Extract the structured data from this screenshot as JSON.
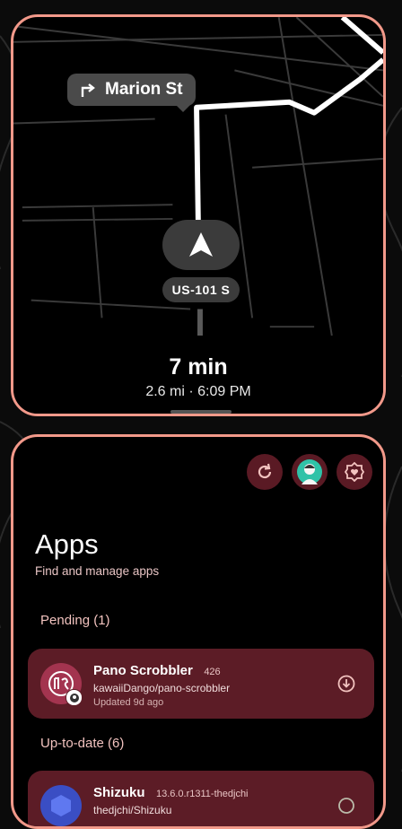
{
  "navigation": {
    "street": "Marion St",
    "road_badge": "US-101 S",
    "eta_time": "7 min",
    "eta_details": "2.6 mi · 6:09 PM"
  },
  "apps": {
    "title": "Apps",
    "subtitle": "Find and manage apps",
    "pending_label": "Pending (1)",
    "uptodate_label": "Up-to-date (6)",
    "pending": [
      {
        "name": "Pano Scrobbler",
        "version": "426",
        "repo": "kawaiiDango/pano-scrobbler",
        "updated": "Updated 9d ago",
        "icon": "pano-scrobbler-icon"
      }
    ],
    "uptodate": [
      {
        "name": "Shizuku",
        "version": "13.6.0.r1311-thedjchi",
        "repo": "thedjchi/Shizuku",
        "icon": "shizuku-icon"
      }
    ]
  },
  "colors": {
    "accent_border": "#f2998a",
    "card_row": "#5c1c26",
    "button_bg": "#5a1a24",
    "text_pink": "#e8c4c4"
  },
  "icons": [
    "turn-right-icon",
    "navigation-arrow-icon",
    "refresh-icon",
    "avatar",
    "settings-icon",
    "download-icon"
  ]
}
